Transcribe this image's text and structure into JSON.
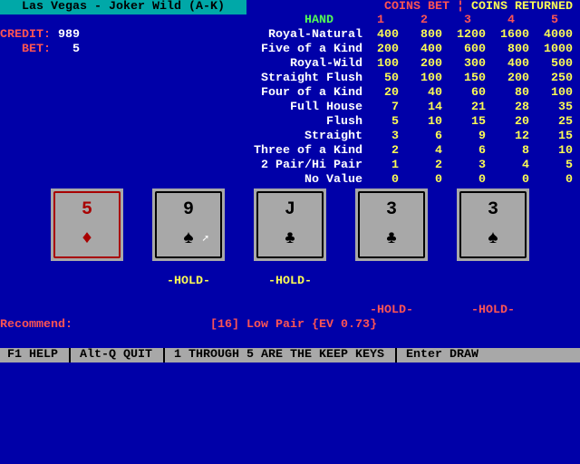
{
  "title": "Las Vegas - Joker Wild (A-K)",
  "credit_label": "CREDIT:",
  "credit": "989",
  "bet_label": "BET:",
  "bet": "5",
  "paytable": {
    "coins_bet": "COINS BET",
    "divider": "¦",
    "coins_returned": "COINS RETURNED",
    "hand_header": "HAND",
    "columns": [
      "1",
      "2",
      "3",
      "4",
      "5"
    ],
    "rows": [
      {
        "hand": "Royal-Natural",
        "pays": [
          "400",
          "800",
          "1200",
          "1600",
          "4000"
        ]
      },
      {
        "hand": "Five of a Kind",
        "pays": [
          "200",
          "400",
          "600",
          "800",
          "1000"
        ]
      },
      {
        "hand": "Royal-Wild",
        "pays": [
          "100",
          "200",
          "300",
          "400",
          "500"
        ]
      },
      {
        "hand": "Straight Flush",
        "pays": [
          "50",
          "100",
          "150",
          "200",
          "250"
        ]
      },
      {
        "hand": "Four of a Kind",
        "pays": [
          "20",
          "40",
          "60",
          "80",
          "100"
        ]
      },
      {
        "hand": "Full House",
        "pays": [
          "7",
          "14",
          "21",
          "28",
          "35"
        ]
      },
      {
        "hand": "Flush",
        "pays": [
          "5",
          "10",
          "15",
          "20",
          "25"
        ]
      },
      {
        "hand": "Straight",
        "pays": [
          "3",
          "6",
          "9",
          "12",
          "15"
        ]
      },
      {
        "hand": "Three of a Kind",
        "pays": [
          "2",
          "4",
          "6",
          "8",
          "10"
        ]
      },
      {
        "hand": "2 Pair/Hi Pair",
        "pays": [
          "1",
          "2",
          "3",
          "4",
          "5"
        ]
      },
      {
        "hand": "No Value",
        "pays": [
          "0",
          "0",
          "0",
          "0",
          "0"
        ]
      }
    ]
  },
  "cards": [
    {
      "rank": "5",
      "suit": "♦",
      "red": true,
      "hold": "",
      "hold_color": ""
    },
    {
      "rank": "9",
      "suit": "♠",
      "red": false,
      "hold": "-HOLD-",
      "hold_color": "yellow"
    },
    {
      "rank": "J",
      "suit": "♣",
      "red": false,
      "hold": "-HOLD-",
      "hold_color": "yellow"
    },
    {
      "rank": "3",
      "suit": "♣",
      "red": false,
      "hold": "-HOLD-",
      "hold_color": "red"
    },
    {
      "rank": "3",
      "suit": "♠",
      "red": false,
      "hold": "-HOLD-",
      "hold_color": "red"
    }
  ],
  "recommend_label": "Recommend:",
  "recommend_text": "[16] Low Pair {EV 0.73}",
  "status_bar": [
    "F1 HELP",
    "Alt-Q QUIT",
    "1 THROUGH 5 ARE THE KEEP KEYS",
    "Enter DRAW"
  ]
}
